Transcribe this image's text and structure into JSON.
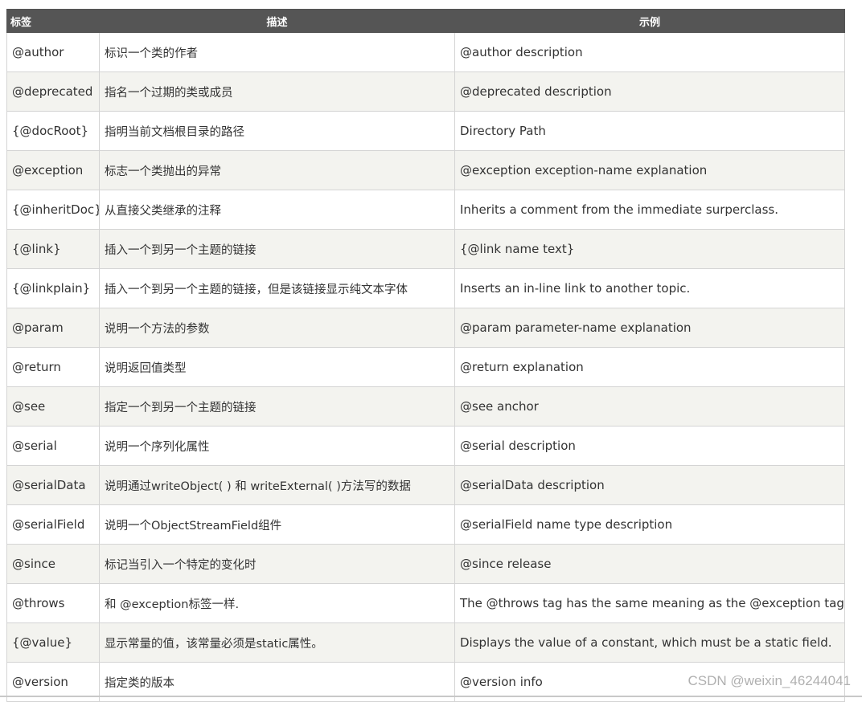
{
  "table": {
    "headers": {
      "tag": "标签",
      "description": "描述",
      "example": "示例"
    },
    "rows": [
      {
        "tag": "@author",
        "description": "标识一个类的作者",
        "example": "@author description"
      },
      {
        "tag": "@deprecated",
        "description": "指名一个过期的类或成员",
        "example": "@deprecated description"
      },
      {
        "tag": "{@docRoot}",
        "description": "指明当前文档根目录的路径",
        "example": "Directory Path"
      },
      {
        "tag": "@exception",
        "description": "标志一个类抛出的异常",
        "example": "@exception exception-name explanation"
      },
      {
        "tag": "{@inheritDoc}",
        "description": "从直接父类继承的注释",
        "example": "Inherits a comment from the immediate surperclass."
      },
      {
        "tag": "{@link}",
        "description": "插入一个到另一个主题的链接",
        "example": "{@link name text}"
      },
      {
        "tag": "{@linkplain}",
        "description": "插入一个到另一个主题的链接，但是该链接显示纯文本字体",
        "example": "Inserts an in-line link to another topic."
      },
      {
        "tag": "@param",
        "description": "说明一个方法的参数",
        "example": "@param parameter-name explanation"
      },
      {
        "tag": "@return",
        "description": "说明返回值类型",
        "example": "@return explanation"
      },
      {
        "tag": "@see",
        "description": "指定一个到另一个主题的链接",
        "example": "@see anchor"
      },
      {
        "tag": "@serial",
        "description": "说明一个序列化属性",
        "example": "@serial description"
      },
      {
        "tag": "@serialData",
        "description": "说明通过writeObject( ) 和 writeExternal( )方法写的数据",
        "example": "@serialData description"
      },
      {
        "tag": "@serialField",
        "description": "说明一个ObjectStreamField组件",
        "example": "@serialField name type description"
      },
      {
        "tag": "@since",
        "description": "标记当引入一个特定的变化时",
        "example": "@since release"
      },
      {
        "tag": "@throws",
        "description": "和 @exception标签一样.",
        "example": "The @throws tag has the same meaning as the @exception tag."
      },
      {
        "tag": "{@value}",
        "description": "显示常量的值，该常量必须是static属性。",
        "example": "Displays the value of a constant, which must be a static field."
      },
      {
        "tag": "@version",
        "description": "指定类的版本",
        "example": "@version info"
      }
    ]
  },
  "watermark": "CSDN @weixin_46244041",
  "colors": {
    "header_bg": "#555555",
    "header_text": "#ffffff",
    "row_alt_bg": "#f3f3ef",
    "border": "#d4d4d4",
    "body_text": "#333333"
  }
}
